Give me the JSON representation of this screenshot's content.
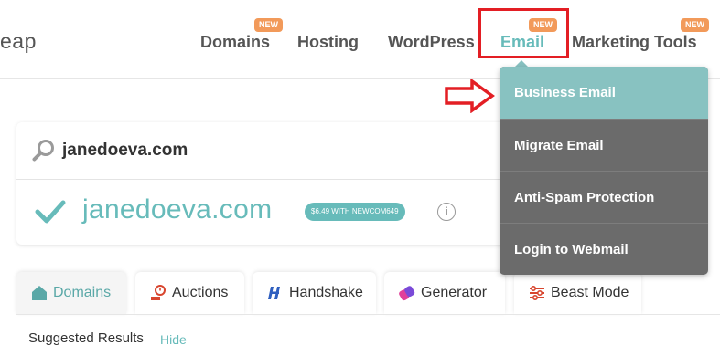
{
  "header": {
    "logo_fragment": "eap",
    "nav": {
      "domains": "Domains",
      "hosting": "Hosting",
      "wordpress": "WordPress",
      "email": "Email",
      "marketing": "Marketing Tools"
    },
    "new_badge": "NEW"
  },
  "email_dropdown": {
    "items": [
      "Business Email",
      "Migrate Email",
      "Anti-Spam Protection",
      "Login to Webmail"
    ]
  },
  "search": {
    "query": "janedoeva.com",
    "result_domain": "janedoeva.com",
    "promo": "$6.49 WITH NEWCOM649",
    "info": "i"
  },
  "tabs": [
    "Domains",
    "Auctions",
    "Handshake",
    "Generator",
    "Beast Mode"
  ],
  "results": {
    "heading": "Suggested Results",
    "hide_label": "Hide"
  },
  "colors": {
    "accent_teal": "#67bbba",
    "dropdown_bg": "#6b6b6b",
    "dropdown_active": "#88c2c1",
    "badge_orange": "#f29a5a",
    "annotation_red": "#e31e24"
  },
  "icons": [
    "search-icon",
    "check-icon",
    "info-icon",
    "home-icon",
    "auction-icon",
    "handshake-icon",
    "generator-icon",
    "beast-mode-icon",
    "red-arrow-icon"
  ]
}
